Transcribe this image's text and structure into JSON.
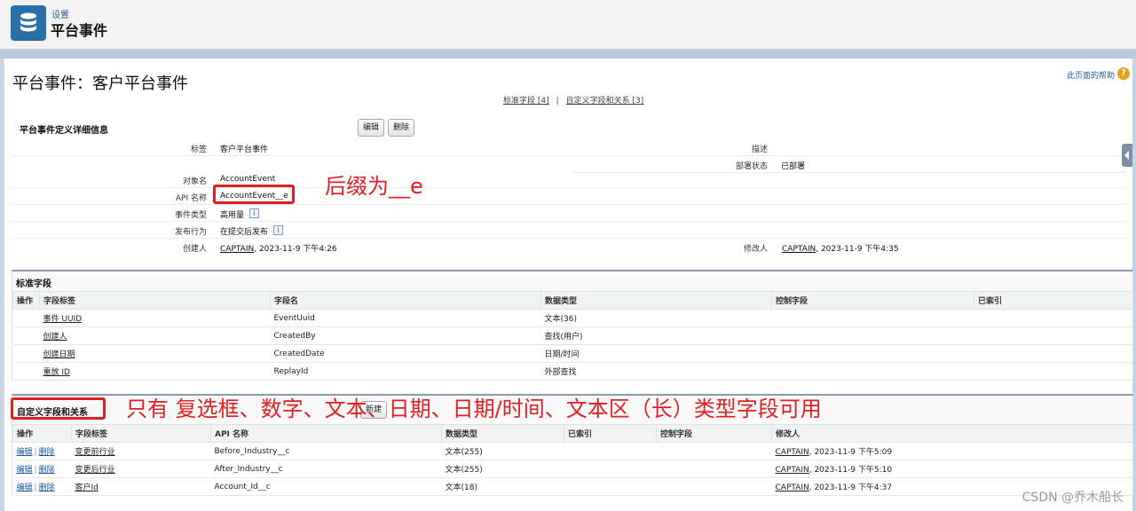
{
  "header": {
    "breadcrumb": "设置",
    "title": "平台事件",
    "icon": "database-icon"
  },
  "page": {
    "title": "平台事件：客户平台事件",
    "help_link": "此页面的帮助",
    "help_icon": "?",
    "anchors": {
      "standard": "标准字段 [4]",
      "sep": "|",
      "custom": "自定义字段和关系 [3]"
    }
  },
  "detail": {
    "section_title": "平台事件定义详细信息",
    "edit_btn": "编辑",
    "delete_btn": "删除",
    "label_l": "标签",
    "label_v": "客户平台事件",
    "desc_l": "描述",
    "deploy_l": "部署状态",
    "deploy_v": "已部署",
    "objname_l": "对象名",
    "objname_v": "AccountEvent",
    "api_l": "API 名称",
    "api_v": "AccountEvent__e",
    "evtype_l": "事件类型",
    "evtype_v": "高用量",
    "publish_l": "发布行为",
    "publish_v": "在提交后发布",
    "info_icon": "i",
    "created_l": "创建人",
    "created_user": "CAPTAIN",
    "created_time": ", 2023-11-9 下午4:26",
    "modified_l": "修改人",
    "modified_user": "CAPTAIN",
    "modified_time": ", 2023-11-9 下午4:35"
  },
  "standard_fields": {
    "title": "标准字段",
    "columns": [
      "操作",
      "字段标签",
      "字段名",
      "数据类型",
      "控制字段",
      "已索引"
    ],
    "rows": [
      {
        "label": "事件 UUID",
        "name": "EventUuid",
        "type": "文本(36)"
      },
      {
        "label": "创建人",
        "name": "CreatedBy",
        "type": "查找(用户)"
      },
      {
        "label": "创建日期",
        "name": "CreatedDate",
        "type": "日期/时间"
      },
      {
        "label": "重放 ID",
        "name": "ReplayId",
        "type": "外部查找"
      }
    ]
  },
  "custom_fields": {
    "title": "自定义字段和关系",
    "new_btn": "新建",
    "columns": [
      "操作",
      "字段标签",
      "API 名称",
      "数据类型",
      "已索引",
      "控制字段",
      "修改人"
    ],
    "edit": "编辑",
    "delete": "删除",
    "sep": "|",
    "rows": [
      {
        "label": "变更前行业",
        "api": "Before_Industry__c",
        "type": "文本(255)",
        "mod_user": "CAPTAIN",
        "mod_time": ", 2023-11-9 下午5:09"
      },
      {
        "label": "变更后行业",
        "api": "After_Industry__c",
        "type": "文本(255)",
        "mod_user": "CAPTAIN",
        "mod_time": ", 2023-11-9 下午5:10"
      },
      {
        "label": "客户Id",
        "api": "Account_Id__c",
        "type": "文本(18)",
        "mod_user": "CAPTAIN",
        "mod_time": ", 2023-11-9 下午4:37"
      }
    ]
  },
  "annotations": {
    "suffix_note": "后缀为__e",
    "types_note": "只有 复选框、数字、文本、日期、日期/时间、文本区（长）类型字段可用",
    "color": "#e02020"
  },
  "watermark": "CSDN @乔木船长"
}
